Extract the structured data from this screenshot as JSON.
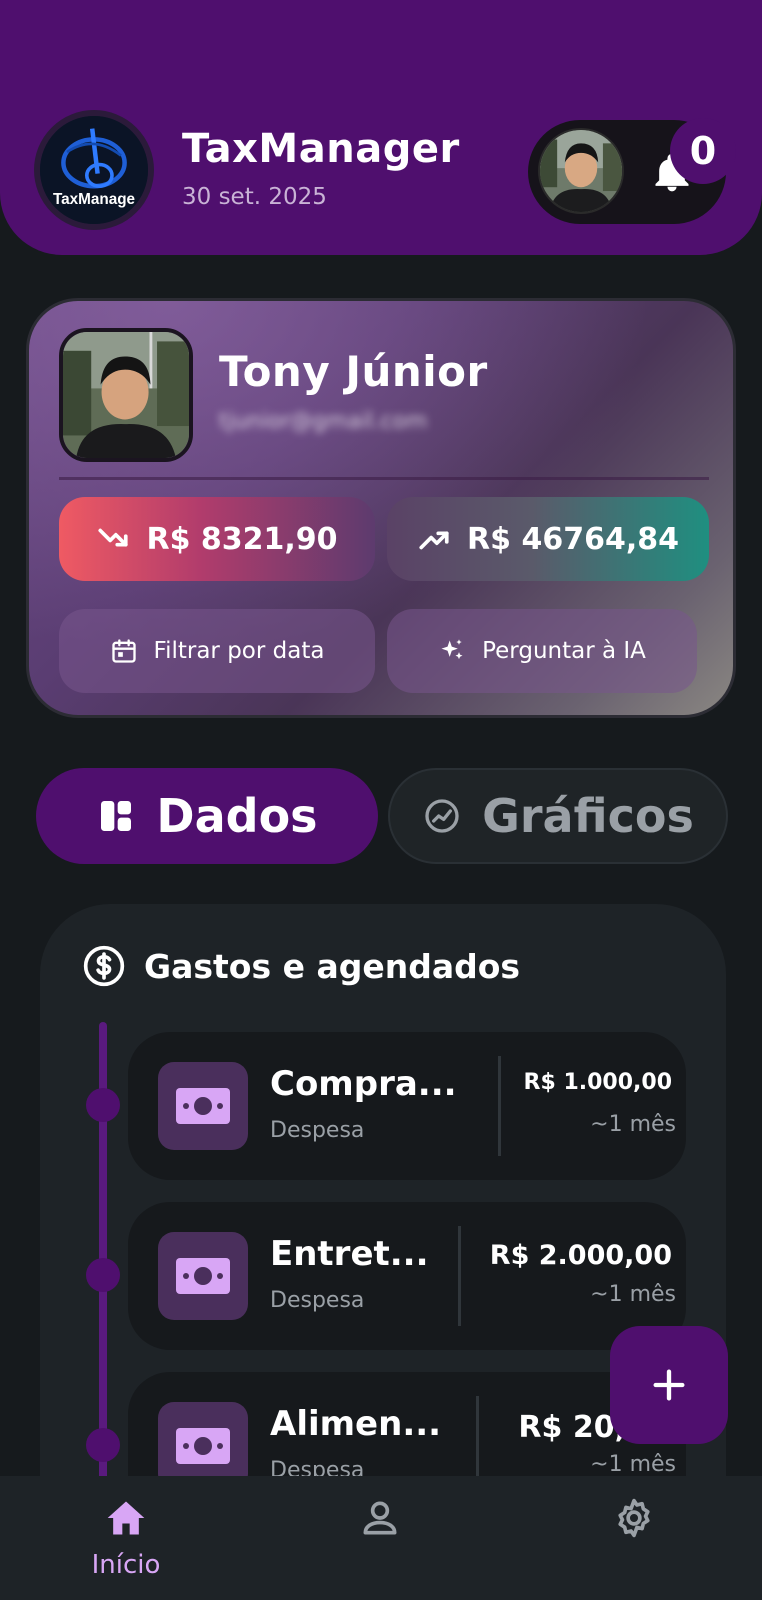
{
  "header": {
    "app_title": "TaxManager",
    "date": "30 set. 2025",
    "logo_text": "TaxManage",
    "notification_count": "0"
  },
  "profile": {
    "name": "Tony Júnior",
    "email": "tjunior@gmail.com",
    "expense_total": "R$ 8321,90",
    "income_total": "R$ 46764,84",
    "filter_label": "Filtrar por data",
    "ai_label": "Perguntar à IA"
  },
  "tabs": [
    {
      "label": "Dados",
      "active": true
    },
    {
      "label": "Gráficos",
      "active": false
    }
  ],
  "expenses": {
    "title": "Gastos e agendados",
    "items": [
      {
        "title": "Compra...",
        "type": "Despesa",
        "amount": "R$ 1.000,00",
        "when": "~1 mês"
      },
      {
        "title": "Entret...",
        "type": "Despesa",
        "amount": "R$ 2.000,00",
        "when": "~1 mês"
      },
      {
        "title": "Alimen...",
        "type": "Despesa",
        "amount": "R$ 20,",
        "when": "~1 mês"
      }
    ]
  },
  "nav": {
    "home_label": "Início"
  },
  "colors": {
    "primary": "#4f0f6e",
    "background": "#161a1d",
    "expense_red": "#ef5a63",
    "income_green": "#1f8f80",
    "accent_lilac": "#d8a6f5"
  },
  "icons": [
    "bell-icon",
    "trending-down-icon",
    "trending-up-icon",
    "calendar-icon",
    "sparkles-icon",
    "dashboard-icon",
    "chart-icon",
    "dollar-circle-icon",
    "money-icon",
    "plus-icon",
    "home-icon",
    "person-icon",
    "gear-icon"
  ]
}
